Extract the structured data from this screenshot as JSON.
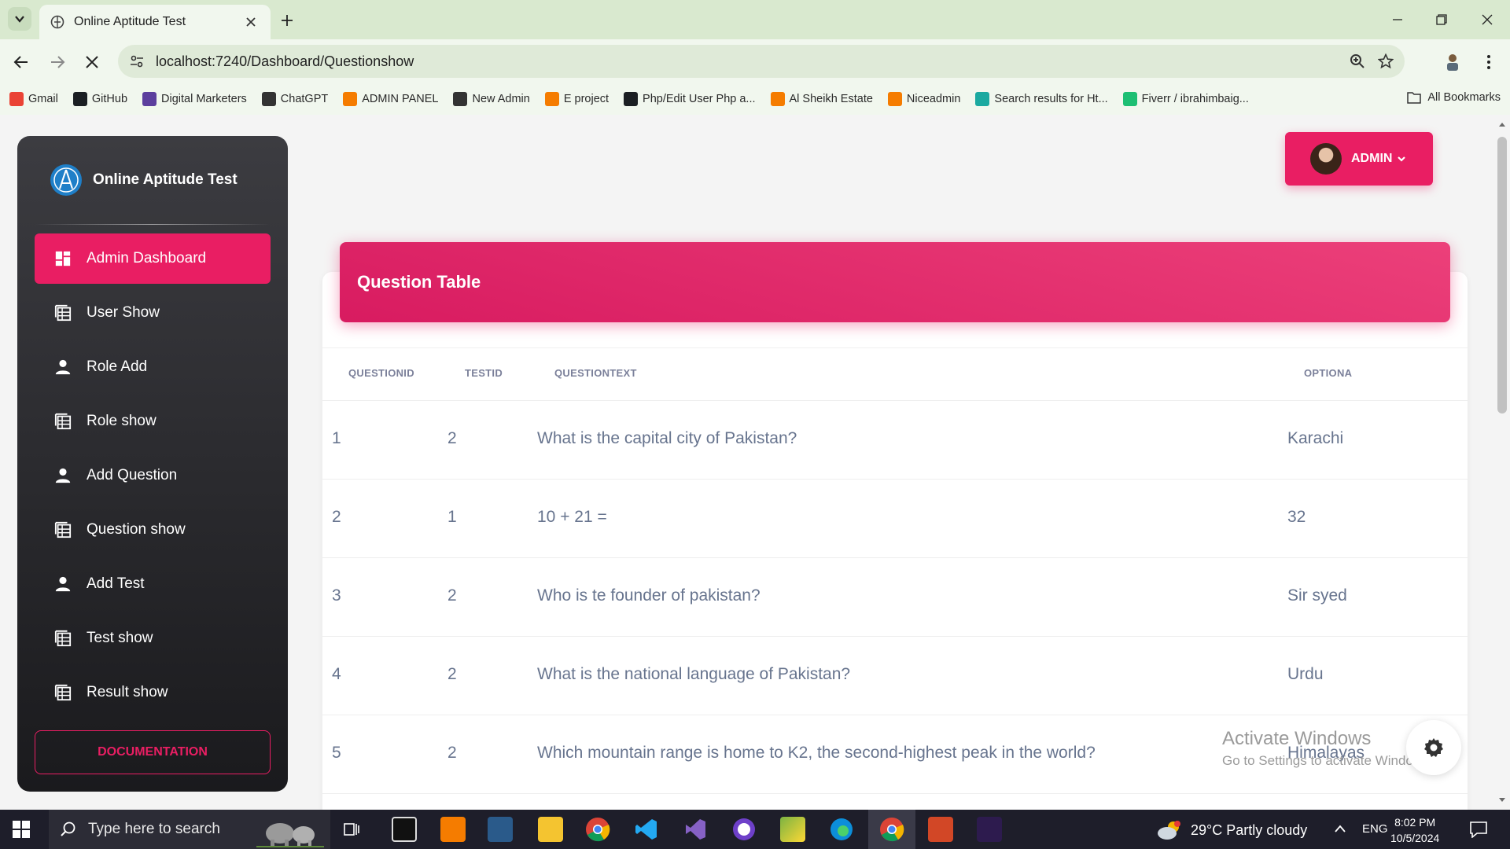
{
  "browser": {
    "tab_title": "Online Aptitude Test",
    "url": "localhost:7240/Dashboard/Questionshow",
    "bookmarks": [
      {
        "label": "Gmail",
        "icon": "gmail-icon",
        "color": "#ea4335"
      },
      {
        "label": "GitHub",
        "icon": "github-icon",
        "color": "#1b1f23"
      },
      {
        "label": "Digital Marketers",
        "icon": "b-icon",
        "color": "#5c3f9e"
      },
      {
        "label": "ChatGPT",
        "icon": "chatgpt-icon",
        "color": "#333333"
      },
      {
        "label": "ADMIN PANEL",
        "icon": "xampp-icon",
        "color": "#f57c00"
      },
      {
        "label": "New Admin",
        "icon": "globe-icon",
        "color": "#333333"
      },
      {
        "label": "E project",
        "icon": "xampp-icon",
        "color": "#f57c00"
      },
      {
        "label": "Php/Edit User Php a...",
        "icon": "github-icon",
        "color": "#1b1f23"
      },
      {
        "label": "Al Sheikh Estate",
        "icon": "xampp-icon",
        "color": "#f57c00"
      },
      {
        "label": "Niceadmin",
        "icon": "xampp-icon",
        "color": "#f57c00"
      },
      {
        "label": "Search results for Ht...",
        "icon": "vuetify-icon",
        "color": "#1ba9a0"
      },
      {
        "label": "Fiverr / ibrahimbaig...",
        "icon": "fiverr-icon",
        "color": "#1dbf73"
      }
    ],
    "all_bookmarks": "All Bookmarks"
  },
  "sidebar": {
    "brand": "Online Aptitude Test",
    "items": [
      {
        "label": "Admin Dashboard",
        "icon": "dashboard-icon",
        "active": true
      },
      {
        "label": "User Show",
        "icon": "table-icon"
      },
      {
        "label": "Role Add",
        "icon": "person-icon"
      },
      {
        "label": "Role show",
        "icon": "table-icon"
      },
      {
        "label": "Add Question",
        "icon": "person-icon"
      },
      {
        "label": "Question show",
        "icon": "table-icon"
      },
      {
        "label": "Add Test",
        "icon": "person-icon"
      },
      {
        "label": "Test show",
        "icon": "table-icon"
      },
      {
        "label": "Result show",
        "icon": "table-icon"
      }
    ],
    "doc_button": "DOCUMENTATION"
  },
  "header": {
    "admin_label": "ADMIN"
  },
  "table": {
    "title": "Question Table",
    "columns": [
      "QUESTIONID",
      "TESTID",
      "QUESTIONTEXT",
      "OPTIONA"
    ],
    "rows": [
      [
        "1",
        "2",
        "What is the capital city of Pakistan?",
        "Karachi"
      ],
      [
        "2",
        "1",
        "10 + 21 =",
        "32"
      ],
      [
        "3",
        "2",
        "Who is te founder of pakistan?",
        "Sir syed"
      ],
      [
        "4",
        "2",
        "What is the national language of Pakistan?",
        "Urdu"
      ],
      [
        "5",
        "2",
        "Which mountain range is home to K2, the second-highest peak in the world?",
        "Himalayas"
      ]
    ]
  },
  "watermark": {
    "line1": "Activate Windows",
    "line2": "Go to Settings to activate Windows."
  },
  "taskbar": {
    "search_placeholder": "Type here to search",
    "weather": "29°C  Partly cloudy",
    "language": "ENG",
    "time": "8:02 PM",
    "date": "10/5/2024"
  },
  "colors": {
    "accent": "#e91e63",
    "sidebar_bg": "#1a1a1d",
    "titlebar": "#d9e9cf"
  }
}
